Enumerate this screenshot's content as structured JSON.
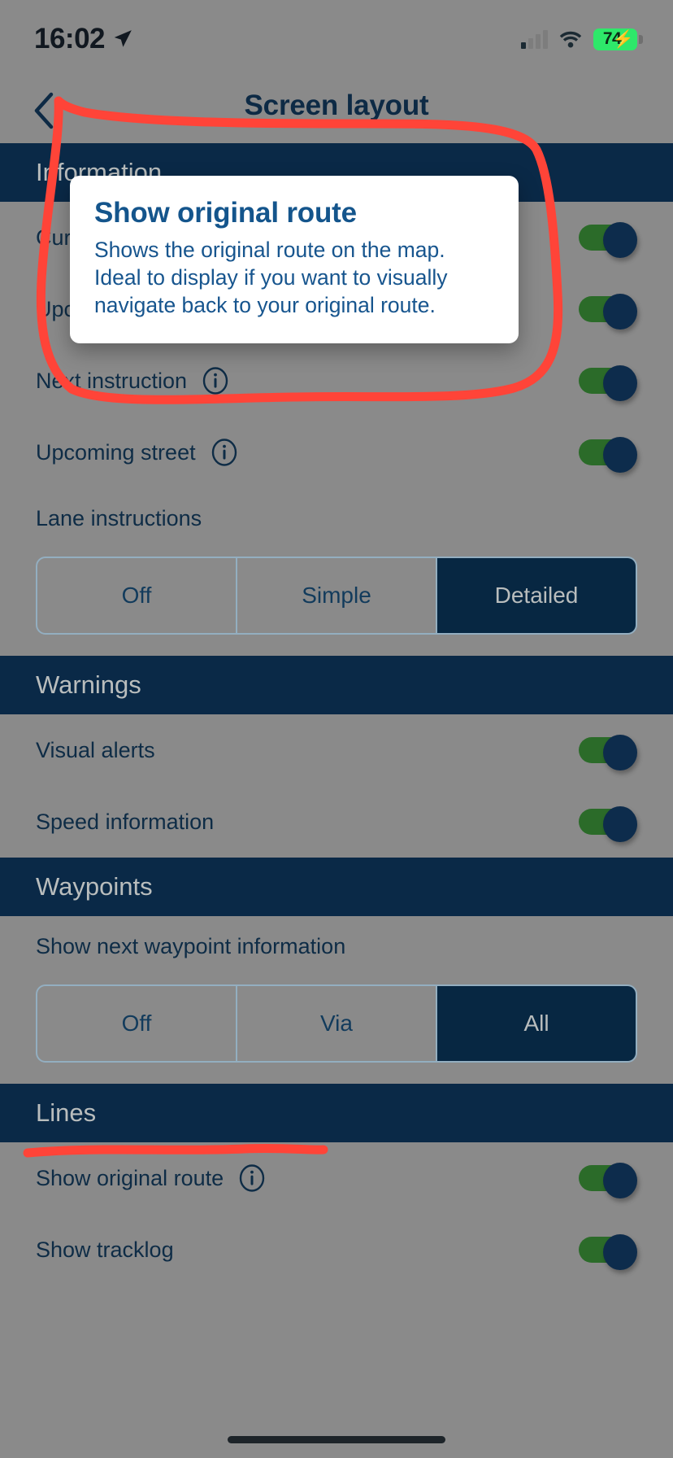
{
  "status_bar": {
    "time": "16:02",
    "location_icon": "location-arrow-icon",
    "cellular_icon": "cellular-bars-icon",
    "wifi_icon": "wifi-icon",
    "battery_percent": "74",
    "battery_charging_icon": "charging-bolt-icon",
    "battery_color": "#2ee86a"
  },
  "header": {
    "back_icon": "chevron-left-icon",
    "title": "Screen layout"
  },
  "theme": {
    "section_header_bg": "#0a2947",
    "section_header_text": "#b9bdbd",
    "label_text": "#0e2c46",
    "toggle_on_track": "#2b6b29",
    "toggle_knob": "#0d2c4c",
    "segment_selected_bg": "#072742",
    "segment_border": "#93aec0",
    "annotation_color": "#ff4438",
    "dim_overlay": "#8a8a8a"
  },
  "sections": [
    {
      "name": "information",
      "title": "Information",
      "rows": [
        {
          "label": "Current street",
          "info": true,
          "toggle": "on"
        },
        {
          "label": "Upcoming turn",
          "info": true,
          "toggle": "on"
        },
        {
          "label": "Next instruction",
          "info": true,
          "toggle": "on"
        },
        {
          "label": "Upcoming street",
          "info": true,
          "toggle": "on"
        }
      ],
      "segmented": {
        "label": "Lane instructions",
        "options": [
          "Off",
          "Simple",
          "Detailed"
        ],
        "selected": "Detailed"
      }
    },
    {
      "name": "warnings",
      "title": "Warnings",
      "rows": [
        {
          "label": "Visual alerts",
          "info": false,
          "toggle": "on"
        },
        {
          "label": "Speed information",
          "info": false,
          "toggle": "on"
        }
      ]
    },
    {
      "name": "waypoints",
      "title": "Waypoints",
      "segmented": {
        "label": "Show next waypoint information",
        "options": [
          "Off",
          "Via",
          "All"
        ],
        "selected": "All"
      }
    },
    {
      "name": "lines",
      "title": "Lines",
      "rows": [
        {
          "label": "Show original route",
          "info": true,
          "toggle": "on"
        },
        {
          "label": "Show tracklog",
          "info": false,
          "toggle": "on"
        }
      ]
    }
  ],
  "tooltip": {
    "title": "Show original route",
    "body": "Shows the original route on the map. Ideal to display if you want to visually navigate back to your original route."
  }
}
